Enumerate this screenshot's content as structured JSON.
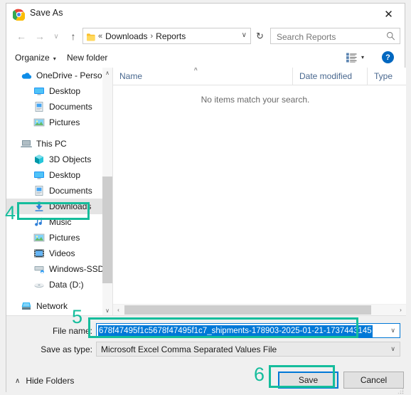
{
  "window": {
    "title": "Save As",
    "app_icon": "chrome-icon",
    "close_label": "✕"
  },
  "addressbar": {
    "back_icon": "←",
    "forward_icon": "→",
    "recent_icon": "∨",
    "up_icon": "↑",
    "folder_icon": "folder-icon",
    "breadcrumb_prefix": "«",
    "crumbs": [
      "Downloads",
      "Reports"
    ],
    "crumb_separator": "›",
    "dropdown_caret": "∨",
    "refresh_icon": "↻",
    "search_placeholder": "Search Reports",
    "search_value": "",
    "search_icon": "search-icon"
  },
  "toolbar": {
    "organize_label": "Organize",
    "organize_caret": "▾",
    "new_folder_label": "New folder",
    "view_icon": "view-list-icon",
    "view_caret": "▾",
    "help_label": "?"
  },
  "navpane": {
    "scroll_up": "∧",
    "scroll_down": "∨",
    "groups": [
      {
        "items": [
          {
            "label": "OneDrive - Person",
            "icon": "onedrive-cloud-icon",
            "level": 0,
            "selected": false
          },
          {
            "label": "Desktop",
            "icon": "desktop-icon",
            "level": 1,
            "selected": false
          },
          {
            "label": "Documents",
            "icon": "documents-icon",
            "level": 1,
            "selected": false
          },
          {
            "label": "Pictures",
            "icon": "pictures-icon",
            "level": 1,
            "selected": false
          }
        ]
      },
      {
        "items": [
          {
            "label": "This PC",
            "icon": "this-pc-icon",
            "level": 0,
            "selected": false
          },
          {
            "label": "3D Objects",
            "icon": "3d-objects-icon",
            "level": 1,
            "selected": false
          },
          {
            "label": "Desktop",
            "icon": "desktop-icon",
            "level": 1,
            "selected": false
          },
          {
            "label": "Documents",
            "icon": "documents-icon",
            "level": 1,
            "selected": false
          },
          {
            "label": "Downloads",
            "icon": "downloads-icon",
            "level": 1,
            "selected": true
          },
          {
            "label": "Music",
            "icon": "music-icon",
            "level": 1,
            "selected": false
          },
          {
            "label": "Pictures",
            "icon": "pictures-icon",
            "level": 1,
            "selected": false
          },
          {
            "label": "Videos",
            "icon": "videos-icon",
            "level": 1,
            "selected": false
          },
          {
            "label": "Windows-SSD (C",
            "icon": "hard-drive-icon",
            "level": 1,
            "selected": false
          },
          {
            "label": "Data (D:)",
            "icon": "disk-drive-icon",
            "level": 1,
            "selected": false
          }
        ]
      },
      {
        "items": [
          {
            "label": "Network",
            "icon": "network-icon",
            "level": 0,
            "selected": false
          }
        ]
      }
    ]
  },
  "filelist": {
    "columns": [
      {
        "key": "name",
        "label": "Name",
        "sorted": true,
        "sort_caret": "∧"
      },
      {
        "key": "date",
        "label": "Date modified",
        "sorted": false,
        "sort_caret": ""
      },
      {
        "key": "type",
        "label": "Type",
        "sorted": false,
        "sort_caret": ""
      }
    ],
    "rows": [],
    "empty_message": "No items match your search.",
    "hscroll_left": "‹",
    "hscroll_right": "›"
  },
  "form": {
    "filename_label": "File name:",
    "filename_value": "678f47495f1c5678f47495f1c7_shipments-178903-2025-01-21-1737443145",
    "filename_caret": "∨",
    "savetype_label": "Save as type:",
    "savetype_value": "Microsoft Excel Comma Separated Values File",
    "savetype_caret": "∨",
    "hide_folders_caret": "∧",
    "hide_folders_label": "Hide Folders",
    "save_label": "Save",
    "cancel_label": "Cancel"
  },
  "annotations": {
    "accent_color": "#15bd9c",
    "steps": [
      {
        "number": "4",
        "target": "Downloads"
      },
      {
        "number": "5",
        "target": "File name"
      },
      {
        "number": "6",
        "target": "Save"
      }
    ]
  }
}
